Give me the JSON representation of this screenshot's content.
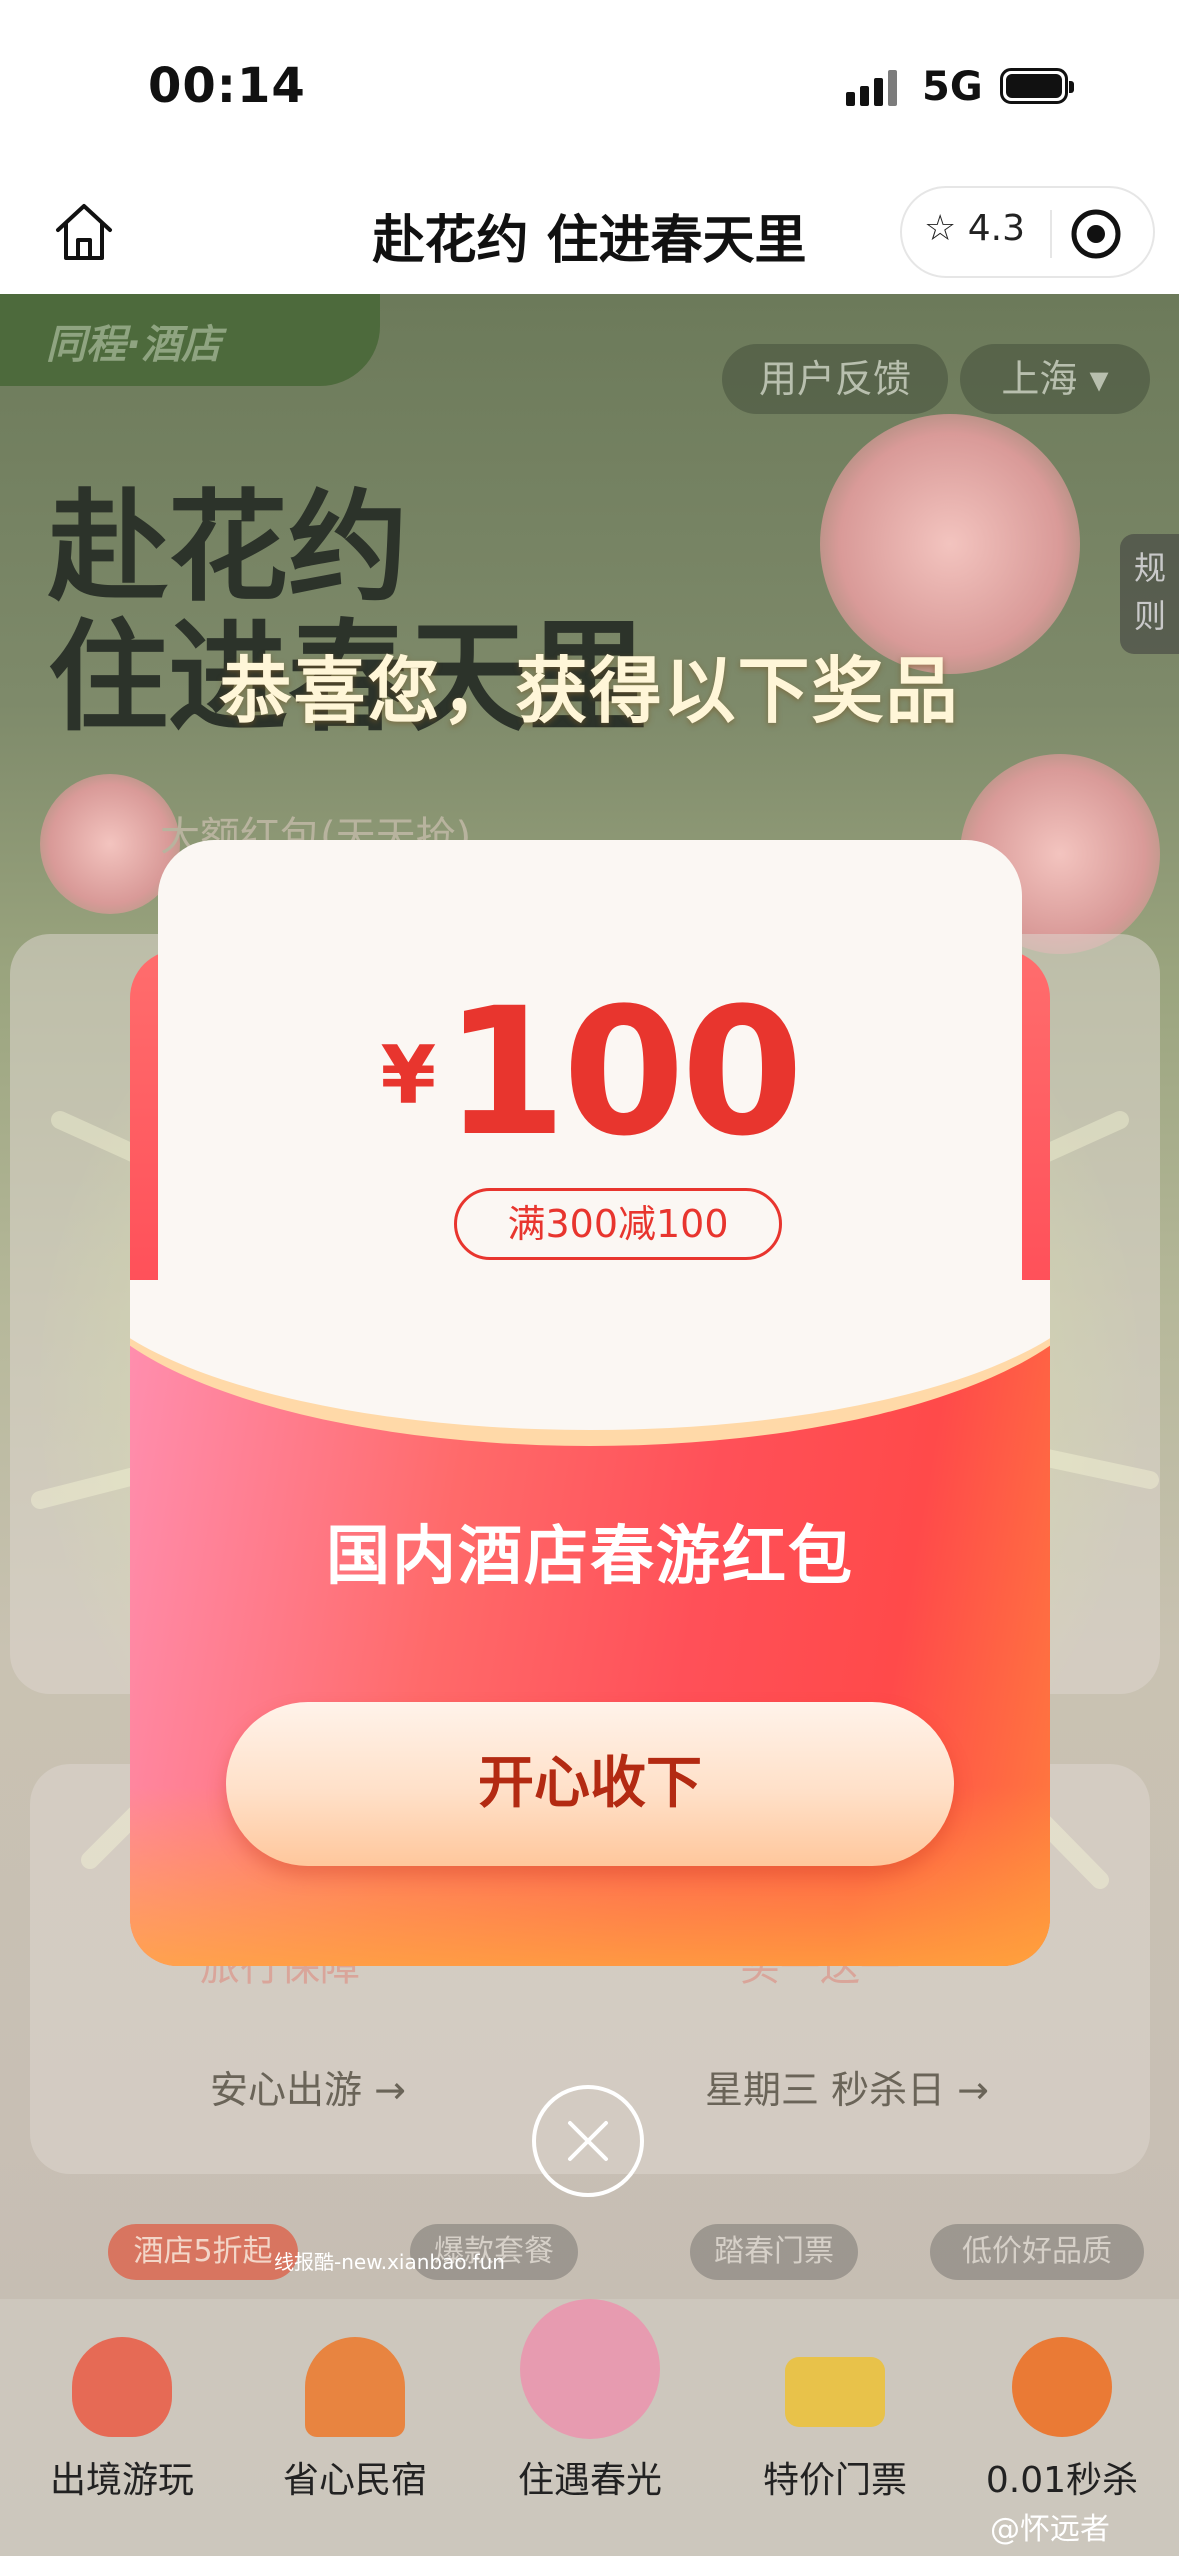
{
  "status_bar": {
    "time": "00:14",
    "network": "5G"
  },
  "nav": {
    "title": "赴花约 住进春天里",
    "rating": "4.3"
  },
  "page": {
    "brand": "同程·酒店",
    "feedback_label": "用户反馈",
    "city": "上海 ▾",
    "rules_label": "规则",
    "headline_line1": "赴花约",
    "headline_line2": "住进春天里",
    "peek_texts": [
      "大额红包(天天抢)",
      "安心出游 →",
      "星期三 秒杀日 →",
      "旅行保障",
      "买一送一"
    ],
    "tags": [
      "酒店5折起",
      "爆款套餐",
      "踏春门票",
      "低价好品质"
    ],
    "watermark": "线报酷-new.xianbao.fun"
  },
  "bottom_tabs": [
    {
      "label": "出境游玩",
      "icon": "hot-air-balloon-icon",
      "color": "#e66a55"
    },
    {
      "label": "省心民宿",
      "icon": "campfire-icon",
      "color": "#e88440"
    },
    {
      "label": "住遇春光",
      "icon": "flower-icon",
      "color": "#e79bb0"
    },
    {
      "label": "特价门票",
      "icon": "ticket-icon",
      "color": "#e8c24a"
    },
    {
      "label": "0.01秒杀",
      "icon": "alarm-clock-icon",
      "color": "#ea7a35"
    }
  ],
  "weibo_handle": "@怀远者",
  "popup": {
    "congrats": "恭喜您，获得以下奖品",
    "currency": "¥",
    "amount": "100",
    "condition": "满300减100",
    "name": "国内酒店春游红包",
    "button": "开心收下"
  }
}
